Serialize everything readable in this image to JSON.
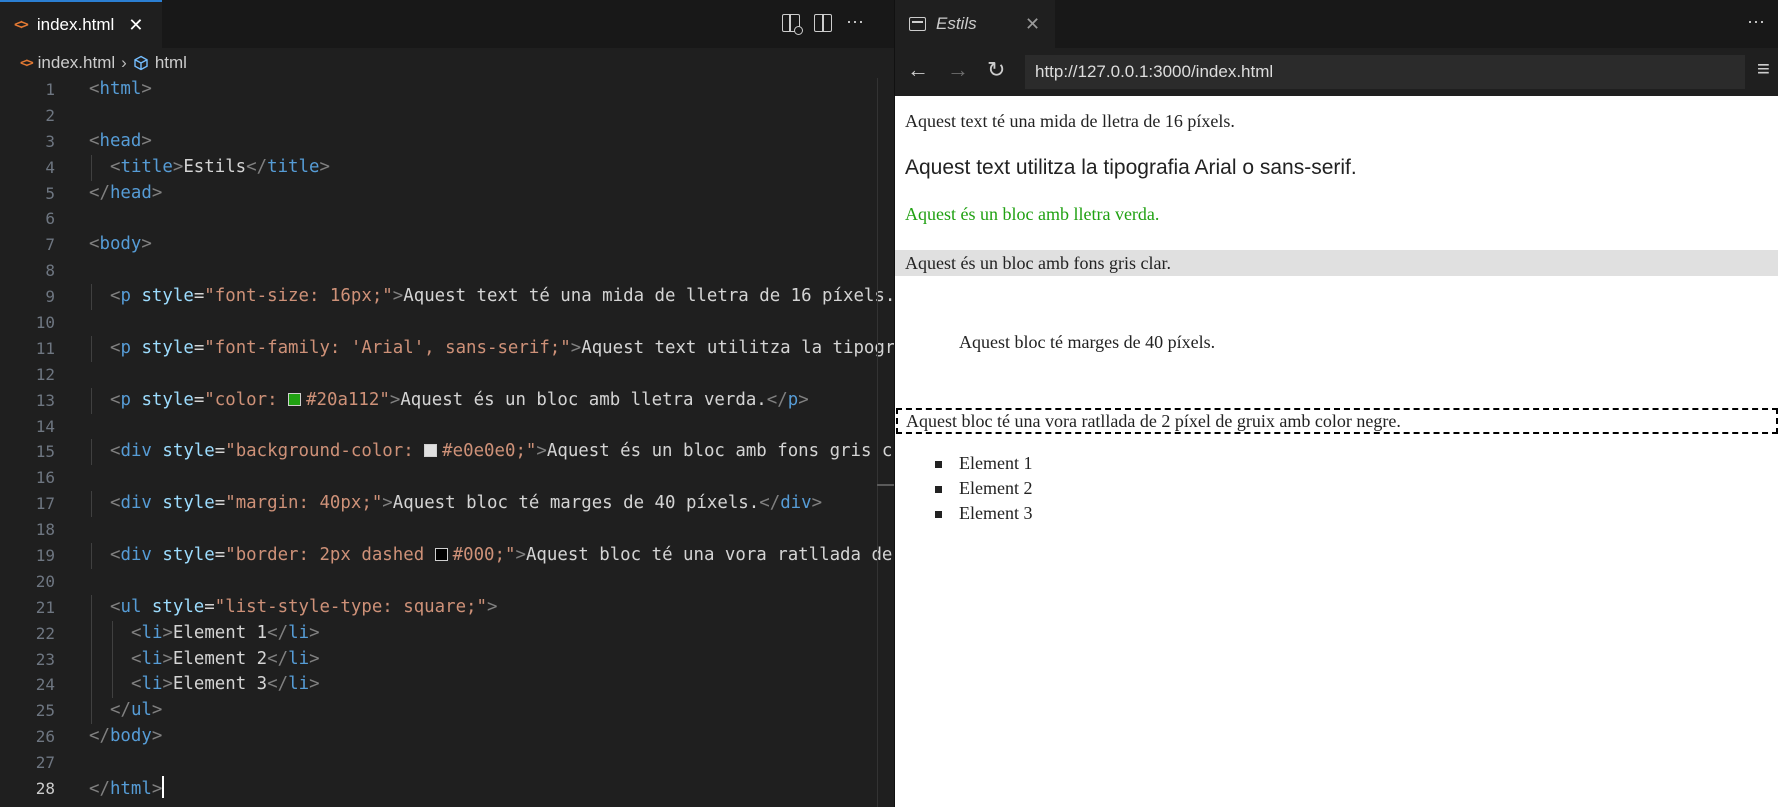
{
  "editor": {
    "tab": {
      "title": "index.html",
      "close": "✕"
    },
    "actions": {
      "more": "⋯"
    },
    "breadcrumb": {
      "file": "index.html",
      "separator": "›",
      "symbol": "html"
    },
    "lines": [
      {
        "n": "1",
        "tokens": [
          [
            "p",
            "<"
          ],
          [
            "t",
            "html"
          ],
          [
            "p",
            ">"
          ]
        ]
      },
      {
        "n": "2",
        "tokens": []
      },
      {
        "n": "3",
        "tokens": [
          [
            "p",
            "<"
          ],
          [
            "t",
            "head"
          ],
          [
            "p",
            ">"
          ]
        ]
      },
      {
        "n": "4",
        "indent": 1,
        "tokens": [
          [
            "p",
            "<"
          ],
          [
            "t",
            "title"
          ],
          [
            "p",
            ">"
          ],
          [
            "x",
            "Estils"
          ],
          [
            "p",
            "</"
          ],
          [
            "t",
            "title"
          ],
          [
            "p",
            ">"
          ]
        ]
      },
      {
        "n": "5",
        "tokens": [
          [
            "p",
            "</"
          ],
          [
            "t",
            "head"
          ],
          [
            "p",
            ">"
          ]
        ]
      },
      {
        "n": "6",
        "tokens": []
      },
      {
        "n": "7",
        "tokens": [
          [
            "p",
            "<"
          ],
          [
            "t",
            "body"
          ],
          [
            "p",
            ">"
          ]
        ]
      },
      {
        "n": "8",
        "tokens": []
      },
      {
        "n": "9",
        "indent": 1,
        "tokens": [
          [
            "p",
            "<"
          ],
          [
            "t",
            "p"
          ],
          [
            "x",
            " "
          ],
          [
            "a",
            "style"
          ],
          [
            "x",
            "="
          ],
          [
            "s",
            "\"font-size: 16px;\""
          ],
          [
            "p",
            ">"
          ],
          [
            "x",
            "Aquest text té una mida de lletra de 16 píxels."
          ]
        ]
      },
      {
        "n": "10",
        "tokens": []
      },
      {
        "n": "11",
        "indent": 1,
        "tokens": [
          [
            "p",
            "<"
          ],
          [
            "t",
            "p"
          ],
          [
            "x",
            " "
          ],
          [
            "a",
            "style"
          ],
          [
            "x",
            "="
          ],
          [
            "s",
            "\"font-family: 'Arial', sans-serif;\""
          ],
          [
            "p",
            ">"
          ],
          [
            "x",
            "Aquest text utilitza la tipogr"
          ]
        ]
      },
      {
        "n": "12",
        "tokens": []
      },
      {
        "n": "13",
        "indent": 1,
        "tokens": [
          [
            "p",
            "<"
          ],
          [
            "t",
            "p"
          ],
          [
            "x",
            " "
          ],
          [
            "a",
            "style"
          ],
          [
            "x",
            "="
          ],
          [
            "s",
            "\"color: "
          ],
          [
            "c",
            "#20a112"
          ],
          [
            "s",
            "#20a112\""
          ],
          [
            "p",
            ">"
          ],
          [
            "x",
            "Aquest és un bloc amb lletra verda."
          ],
          [
            "p",
            "</"
          ],
          [
            "t",
            "p"
          ],
          [
            "p",
            ">"
          ]
        ]
      },
      {
        "n": "14",
        "tokens": []
      },
      {
        "n": "15",
        "indent": 1,
        "tokens": [
          [
            "p",
            "<"
          ],
          [
            "t",
            "div"
          ],
          [
            "x",
            " "
          ],
          [
            "a",
            "style"
          ],
          [
            "x",
            "="
          ],
          [
            "s",
            "\"background-color: "
          ],
          [
            "c",
            "#e0e0e0"
          ],
          [
            "s",
            "#e0e0e0;\""
          ],
          [
            "p",
            ">"
          ],
          [
            "x",
            "Aquest és un bloc amb fons gris c"
          ]
        ]
      },
      {
        "n": "16",
        "tokens": []
      },
      {
        "n": "17",
        "indent": 1,
        "tokens": [
          [
            "p",
            "<"
          ],
          [
            "t",
            "div"
          ],
          [
            "x",
            " "
          ],
          [
            "a",
            "style"
          ],
          [
            "x",
            "="
          ],
          [
            "s",
            "\"margin: 40px;\""
          ],
          [
            "p",
            ">"
          ],
          [
            "x",
            "Aquest bloc té marges de 40 píxels."
          ],
          [
            "p",
            "</"
          ],
          [
            "t",
            "div"
          ],
          [
            "p",
            ">"
          ]
        ]
      },
      {
        "n": "18",
        "tokens": []
      },
      {
        "n": "19",
        "indent": 1,
        "tokens": [
          [
            "p",
            "<"
          ],
          [
            "t",
            "div"
          ],
          [
            "x",
            " "
          ],
          [
            "a",
            "style"
          ],
          [
            "x",
            "="
          ],
          [
            "s",
            "\"border: 2px dashed "
          ],
          [
            "c",
            "#000000"
          ],
          [
            "s",
            "#000;\""
          ],
          [
            "p",
            ">"
          ],
          [
            "x",
            "Aquest bloc té una vora ratllada de"
          ]
        ]
      },
      {
        "n": "20",
        "tokens": []
      },
      {
        "n": "21",
        "indent": 1,
        "tokens": [
          [
            "p",
            "<"
          ],
          [
            "t",
            "ul"
          ],
          [
            "x",
            " "
          ],
          [
            "a",
            "style"
          ],
          [
            "x",
            "="
          ],
          [
            "s",
            "\"list-style-type: square;\""
          ],
          [
            "p",
            ">"
          ]
        ]
      },
      {
        "n": "22",
        "indent": 2,
        "tokens": [
          [
            "p",
            "<"
          ],
          [
            "t",
            "li"
          ],
          [
            "p",
            ">"
          ],
          [
            "x",
            "Element 1"
          ],
          [
            "p",
            "</"
          ],
          [
            "t",
            "li"
          ],
          [
            "p",
            ">"
          ]
        ]
      },
      {
        "n": "23",
        "indent": 2,
        "tokens": [
          [
            "p",
            "<"
          ],
          [
            "t",
            "li"
          ],
          [
            "p",
            ">"
          ],
          [
            "x",
            "Element 2"
          ],
          [
            "p",
            "</"
          ],
          [
            "t",
            "li"
          ],
          [
            "p",
            ">"
          ]
        ]
      },
      {
        "n": "24",
        "indent": 2,
        "tokens": [
          [
            "p",
            "<"
          ],
          [
            "t",
            "li"
          ],
          [
            "p",
            ">"
          ],
          [
            "x",
            "Element 3"
          ],
          [
            "p",
            "</"
          ],
          [
            "t",
            "li"
          ],
          [
            "p",
            ">"
          ]
        ]
      },
      {
        "n": "25",
        "indent": 1,
        "tokens": [
          [
            "p",
            "</"
          ],
          [
            "t",
            "ul"
          ],
          [
            "p",
            ">"
          ]
        ]
      },
      {
        "n": "26",
        "tokens": [
          [
            "p",
            "</"
          ],
          [
            "t",
            "body"
          ],
          [
            "p",
            ">"
          ]
        ]
      },
      {
        "n": "27",
        "tokens": []
      },
      {
        "n": "28",
        "current": true,
        "tokens": [
          [
            "p",
            "</"
          ],
          [
            "t",
            "html"
          ],
          [
            "p",
            ">"
          ],
          [
            "cursor",
            ""
          ]
        ]
      }
    ]
  },
  "browser": {
    "tab": {
      "title": "Estils",
      "close": "✕"
    },
    "more": "⋯",
    "nav": {
      "back": "←",
      "forward": "→",
      "reload": "↻",
      "menu": "≡"
    },
    "url": "http://127.0.0.1:3000/index.html",
    "page": {
      "p1": "Aquest text té una mida de lletra de 16 píxels.",
      "p2": "Aquest text utilitza la tipografia Arial o sans-serif.",
      "p3": "Aquest és un bloc amb lletra verda.",
      "d1": "Aquest és un bloc amb fons gris clar.",
      "d2": "Aquest bloc té marges de 40 píxels.",
      "d3": "Aquest bloc té una vora ratllada de 2 píxel de gruix amb color negre.",
      "list": [
        "Element 1",
        "Element 2",
        "Element 3"
      ]
    }
  },
  "colors": {
    "green_text": "#20a112",
    "gray_bg": "#e0e0e0",
    "border_black": "#000000",
    "tab_accent": "#2b7fd3"
  }
}
